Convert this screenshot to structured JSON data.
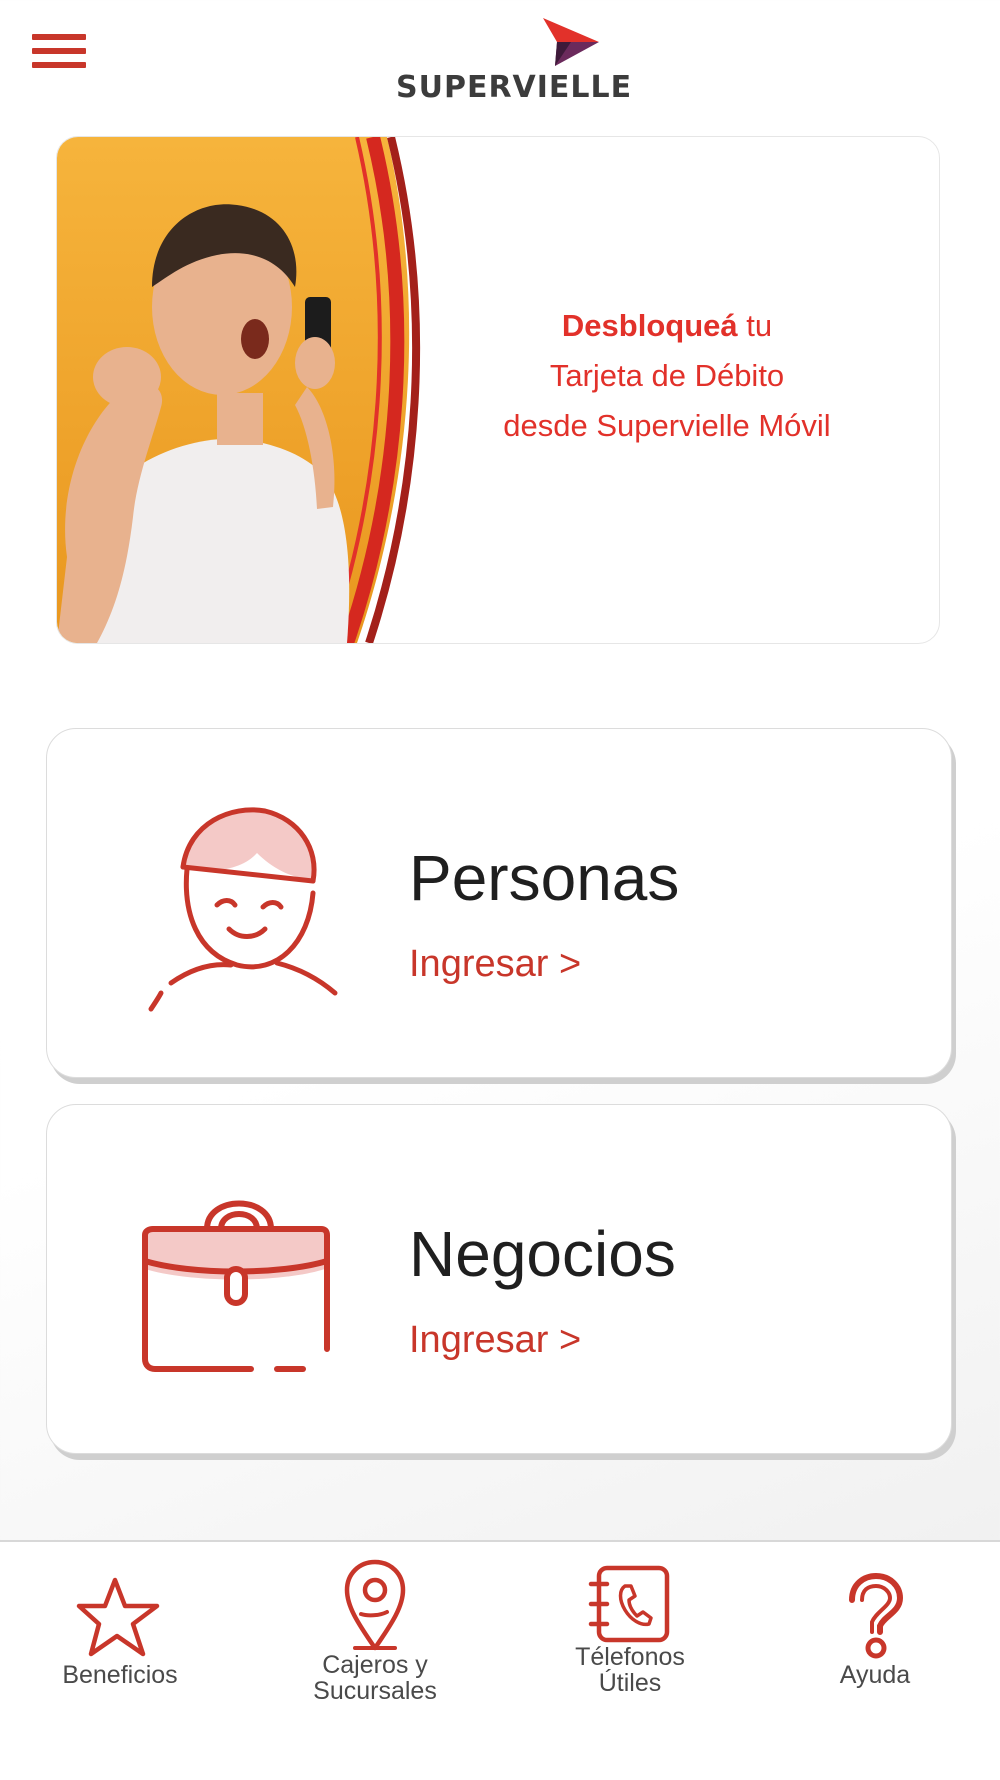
{
  "header": {
    "menu_icon": "hamburger-menu-icon",
    "logo_text": "SUPERVIELLE"
  },
  "banner": {
    "line1_bold": "Desbloqueá",
    "line1_rest": " tu",
    "line2": "Tarjeta de Débito",
    "line3": "desde Supervielle Móvil"
  },
  "cards": {
    "personas": {
      "title": "Personas",
      "link": "Ingresar >",
      "icon": "person-icon"
    },
    "negocios": {
      "title": "Negocios",
      "link": "Ingresar >",
      "icon": "briefcase-icon"
    }
  },
  "bottom_nav": {
    "beneficios": {
      "line1": "Beneficios",
      "icon": "star-icon"
    },
    "cajeros": {
      "line1": "Cajeros y",
      "line2": "Sucursales",
      "icon": "location-pin-icon"
    },
    "telefonos": {
      "line1": "Télefonos",
      "line2": "Útiles",
      "icon": "phone-book-icon"
    },
    "ayuda": {
      "line1": "Ayuda",
      "icon": "question-mark-icon"
    }
  },
  "colors": {
    "accent": "#c8362a",
    "banner_red": "#e2312a",
    "banner_orange": "#f2ad35"
  }
}
